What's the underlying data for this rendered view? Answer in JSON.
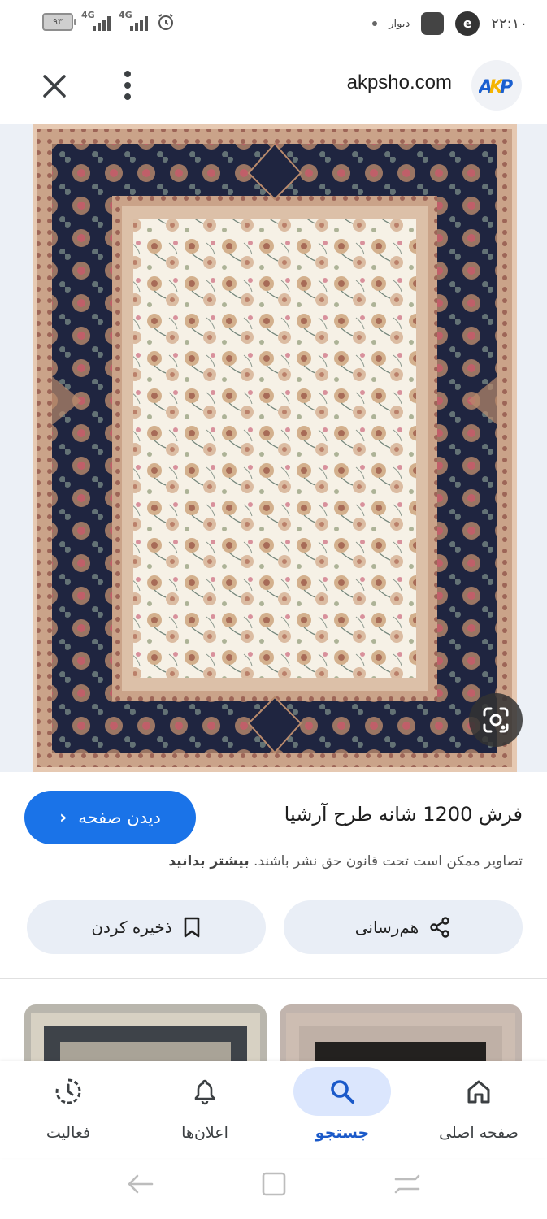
{
  "status_bar": {
    "time": "۲۲:۱۰",
    "notification_app": "دیوار",
    "battery": "۹۳",
    "network_1": "4G",
    "network_2": "4G",
    "icons": [
      "battery-icon",
      "signal-icon",
      "signal-icon",
      "alarm-icon",
      "app-icon",
      "app-icon"
    ]
  },
  "header": {
    "domain": "akpsho.com",
    "logo_text": "AKP",
    "close_icon": "close-icon",
    "menu_icon": "more-vert-icon"
  },
  "image": {
    "lens_icon": "google-lens-icon"
  },
  "info": {
    "title": "فرش 1200 شانه طرح آرشیا",
    "visit_button": "دیدن صفحه",
    "copyright_text": "تصاویر ممکن است تحت قانون حق نشر باشند.",
    "copyright_link": "بیشتر بدانید"
  },
  "actions": {
    "share": "هم‌رسانی",
    "save": "ذخیره کردن"
  },
  "bottom_nav": {
    "items": [
      {
        "label": "صفحه اصلی",
        "icon": "home-icon",
        "active": false
      },
      {
        "label": "جستجو",
        "icon": "search-icon",
        "active": true
      },
      {
        "label": "اعلان‌ها",
        "icon": "bell-icon",
        "active": false
      },
      {
        "label": "فعالیت",
        "icon": "activity-icon",
        "active": false
      }
    ]
  },
  "colors": {
    "accent": "#1a73e8",
    "action_bg": "#e9eef6",
    "active_nav_pill": "#dbe6fd",
    "rug_navy": "#1f2540",
    "rug_border": "#b58a6e",
    "rug_field": "#f6f1e6"
  }
}
